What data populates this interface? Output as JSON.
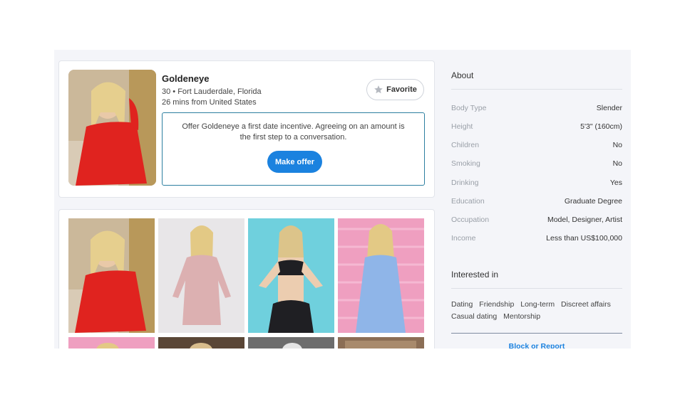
{
  "profile": {
    "name": "Goldeneye",
    "age_location": "30 • Fort Lauderdale, Florida",
    "last_active": "26 mins from United States",
    "favorite_label": "Favorite"
  },
  "offer": {
    "text": "Offer Goldeneye a first date incentive. Agreeing on an amount is the first step to a conversation.",
    "button_label": "Make offer"
  },
  "about": {
    "title": "About",
    "attributes": [
      {
        "label": "Body Type",
        "value": "Slender"
      },
      {
        "label": "Height",
        "value": "5'3\" (160cm)"
      },
      {
        "label": "Children",
        "value": "No"
      },
      {
        "label": "Smoking",
        "value": "No"
      },
      {
        "label": "Drinking",
        "value": "Yes"
      },
      {
        "label": "Education",
        "value": "Graduate Degree"
      },
      {
        "label": "Occupation",
        "value": "Model, Designer, Artist"
      },
      {
        "label": "Income",
        "value": "Less than US$100,000"
      }
    ]
  },
  "interested_in": {
    "title": "Interested in",
    "items": [
      "Dating",
      "Friendship",
      "Long-term",
      "Discreet affairs",
      "Casual dating",
      "Mentorship"
    ]
  },
  "block_report_label": "Block or Report",
  "colors": {
    "accent": "#1b82df",
    "offer_border": "#2d7fa0",
    "background": "#f4f5f9"
  }
}
